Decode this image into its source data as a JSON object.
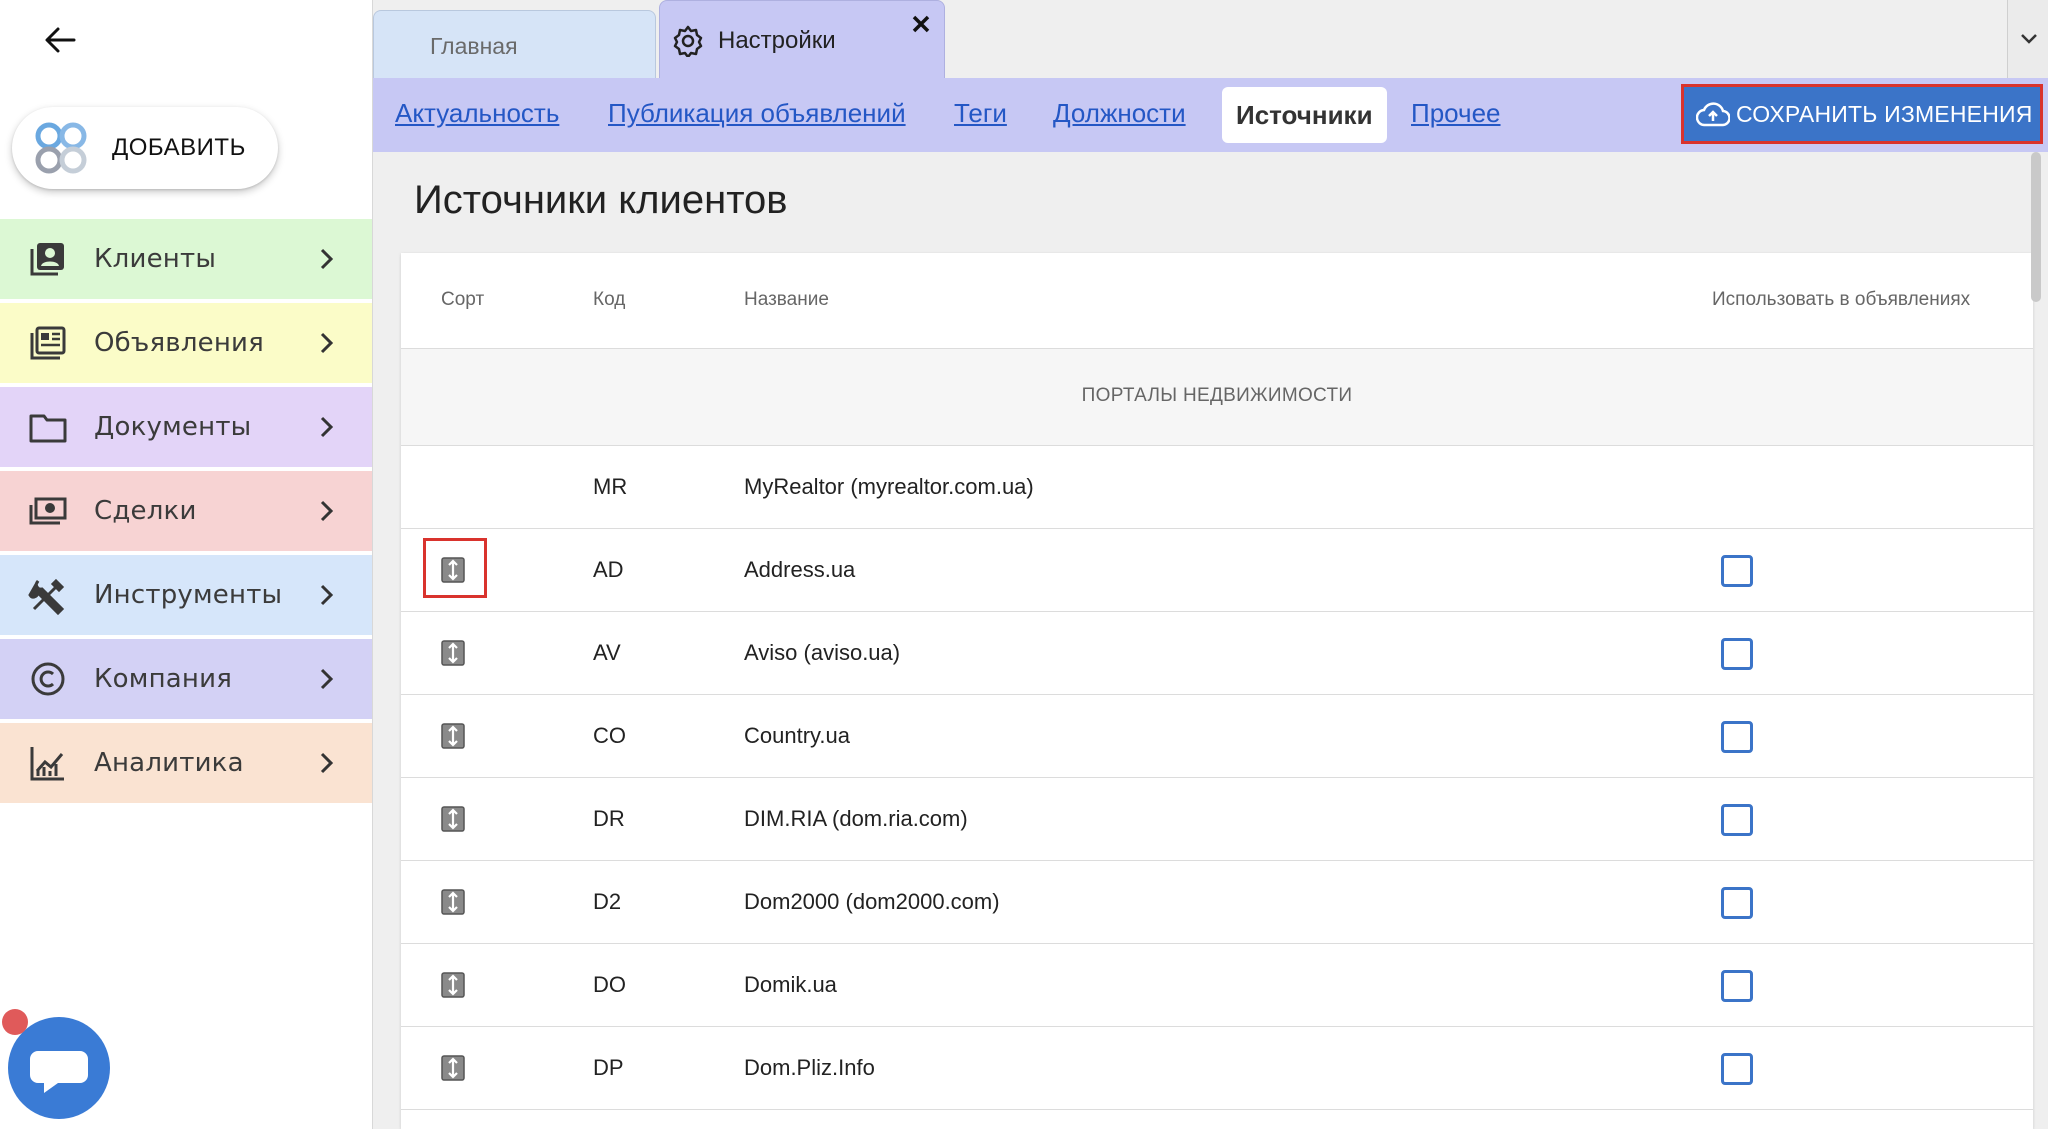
{
  "sidebar": {
    "add_label": "ДОБАВИТЬ",
    "items": [
      {
        "label": "Клиенты",
        "color": "#dcf8d4",
        "icon": "contacts-icon"
      },
      {
        "label": "Объявления",
        "color": "#fbfcc8",
        "icon": "newspaper-icon"
      },
      {
        "label": "Документы",
        "color": "#e3d4f8",
        "icon": "folder-icon"
      },
      {
        "label": "Сделки",
        "color": "#f7d3d3",
        "icon": "money-icon"
      },
      {
        "label": "Инструменты",
        "color": "#d6e6fa",
        "icon": "tools-icon"
      },
      {
        "label": "Компания",
        "color": "#d3d1f5",
        "icon": "copyright-icon"
      },
      {
        "label": "Аналитика",
        "color": "#fae3d2",
        "icon": "analytics-icon"
      }
    ]
  },
  "tabs": {
    "home": "Главная",
    "settings": "Настройки"
  },
  "subnav": {
    "items": [
      "Актуальность",
      "Публикация объявлений",
      "Теги",
      "Должности",
      "Источники",
      "Прочее"
    ],
    "active": "Источники",
    "save_label": "СОХРАНИТЬ ИЗМЕНЕНИЯ"
  },
  "main": {
    "title": "Источники клиентов"
  },
  "table": {
    "headers": {
      "sort": "Сорт",
      "code": "Код",
      "name": "Название",
      "use": "Использовать в объявлениях"
    },
    "group": "ПОРТАЛЫ НЕДВИЖИМОСТИ",
    "rows": [
      {
        "code": "MR",
        "name": "MyRealtor (myrealtor.com.ua)",
        "sortable": false,
        "checked": false
      },
      {
        "code": "AD",
        "name": "Address.ua",
        "sortable": true,
        "checked": false
      },
      {
        "code": "AV",
        "name": "Aviso (aviso.ua)",
        "sortable": true,
        "checked": false
      },
      {
        "code": "CO",
        "name": "Country.ua",
        "sortable": true,
        "checked": false
      },
      {
        "code": "DR",
        "name": "DIM.RIA (dom.ria.com)",
        "sortable": true,
        "checked": false
      },
      {
        "code": "D2",
        "name": "Dom2000 (dom2000.com)",
        "sortable": true,
        "checked": false
      },
      {
        "code": "DO",
        "name": "Domik.ua",
        "sortable": true,
        "checked": false
      },
      {
        "code": "DP",
        "name": "Dom.Pliz.Info",
        "sortable": true,
        "checked": false
      }
    ]
  },
  "colors": {
    "accent": "#3b74c8",
    "highlight": "#d9332d",
    "subnav_bg": "#c7c8f4"
  }
}
